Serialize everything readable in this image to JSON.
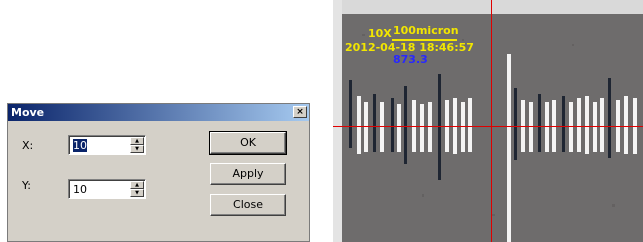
{
  "dialog": {
    "title": "Move",
    "close_glyph": "×",
    "x_label": "X:",
    "x_value": "10",
    "y_label": "Y:",
    "y_value": "10",
    "ok_label": "OK",
    "apply_label": "Apply",
    "close_label": "Close"
  },
  "overlay": {
    "magnification": "10X",
    "scale": "100micron",
    "timestamp": "2012-04-18 18:46:57",
    "measurement": "873.3"
  },
  "colors": {
    "overlay_text": "#f2e600",
    "measurement_text": "#2828ff",
    "crosshair": "#e00000"
  }
}
